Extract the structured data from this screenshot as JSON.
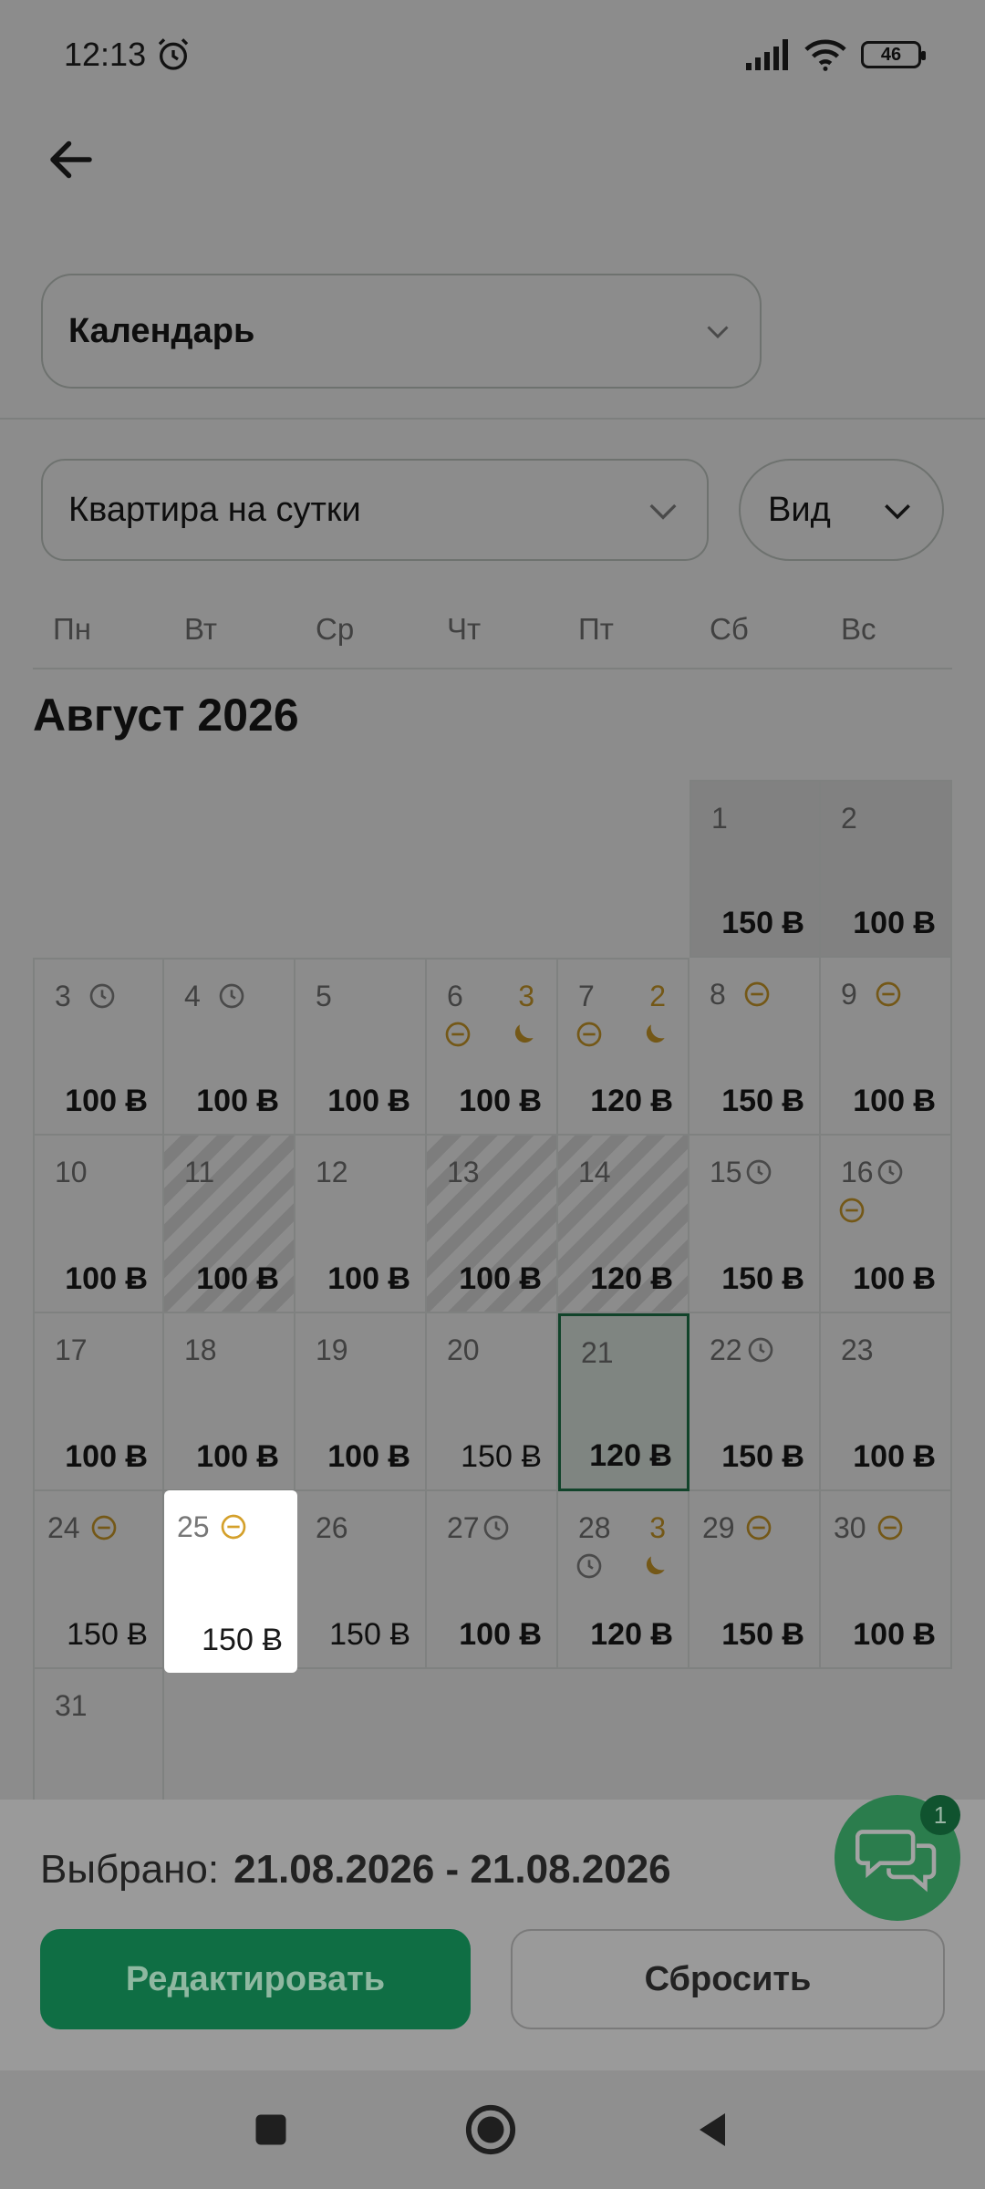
{
  "status_bar": {
    "time": "12:13",
    "battery": "46"
  },
  "header": {
    "calendar_dropdown": "Календарь"
  },
  "filters": {
    "property": "Квартира на сутки",
    "view": "Вид"
  },
  "weekdays": [
    "Пн",
    "Вт",
    "Ср",
    "Чт",
    "Пт",
    "Сб",
    "Вс"
  ],
  "month_title": "Август 2026",
  "days": {
    "d1": {
      "num": "1",
      "price": "150 Ƀ"
    },
    "d2": {
      "num": "2",
      "price": "100 Ƀ"
    },
    "d3": {
      "num": "3",
      "price": "100 Ƀ"
    },
    "d4": {
      "num": "4",
      "price": "100 Ƀ"
    },
    "d5": {
      "num": "5",
      "price": "100 Ƀ"
    },
    "d6": {
      "num": "6",
      "extra": "3",
      "price": "100 Ƀ"
    },
    "d7": {
      "num": "7",
      "extra": "2",
      "price": "120 Ƀ"
    },
    "d8": {
      "num": "8",
      "price": "150 Ƀ"
    },
    "d9": {
      "num": "9",
      "price": "100 Ƀ"
    },
    "d10": {
      "num": "10",
      "price": "100 Ƀ"
    },
    "d11": {
      "num": "11",
      "price": "100 Ƀ"
    },
    "d12": {
      "num": "12",
      "price": "100 Ƀ"
    },
    "d13": {
      "num": "13",
      "price": "100 Ƀ"
    },
    "d14": {
      "num": "14",
      "price": "120 Ƀ"
    },
    "d15": {
      "num": "15",
      "price": "150 Ƀ"
    },
    "d16": {
      "num": "16",
      "price": "100 Ƀ"
    },
    "d17": {
      "num": "17",
      "price": "100 Ƀ"
    },
    "d18": {
      "num": "18",
      "price": "100 Ƀ"
    },
    "d19": {
      "num": "19",
      "price": "100 Ƀ"
    },
    "d20": {
      "num": "20",
      "price": "150 Ƀ"
    },
    "d21": {
      "num": "21",
      "price": "120 Ƀ"
    },
    "d22": {
      "num": "22",
      "price": "150 Ƀ"
    },
    "d23": {
      "num": "23",
      "price": "100 Ƀ"
    },
    "d24": {
      "num": "24",
      "price": "150 Ƀ"
    },
    "d25": {
      "num": "25",
      "price": "150 Ƀ"
    },
    "d26": {
      "num": "26",
      "price": "150 Ƀ"
    },
    "d27": {
      "num": "27",
      "price": "100 Ƀ"
    },
    "d28": {
      "num": "28",
      "extra": "3",
      "price": "120 Ƀ"
    },
    "d29": {
      "num": "29",
      "price": "150 Ƀ"
    },
    "d30": {
      "num": "30",
      "price": "100 Ƀ"
    },
    "d31": {
      "num": "31"
    }
  },
  "selection": {
    "label": "Выбрано:",
    "range": "21.08.2026 - 21.08.2026"
  },
  "buttons": {
    "edit": "Редактировать",
    "reset": "Сбросить"
  },
  "chat": {
    "badge": "1"
  },
  "colors": {
    "accent": "#1f9d5c",
    "icon_amber": "#d4a02b"
  }
}
